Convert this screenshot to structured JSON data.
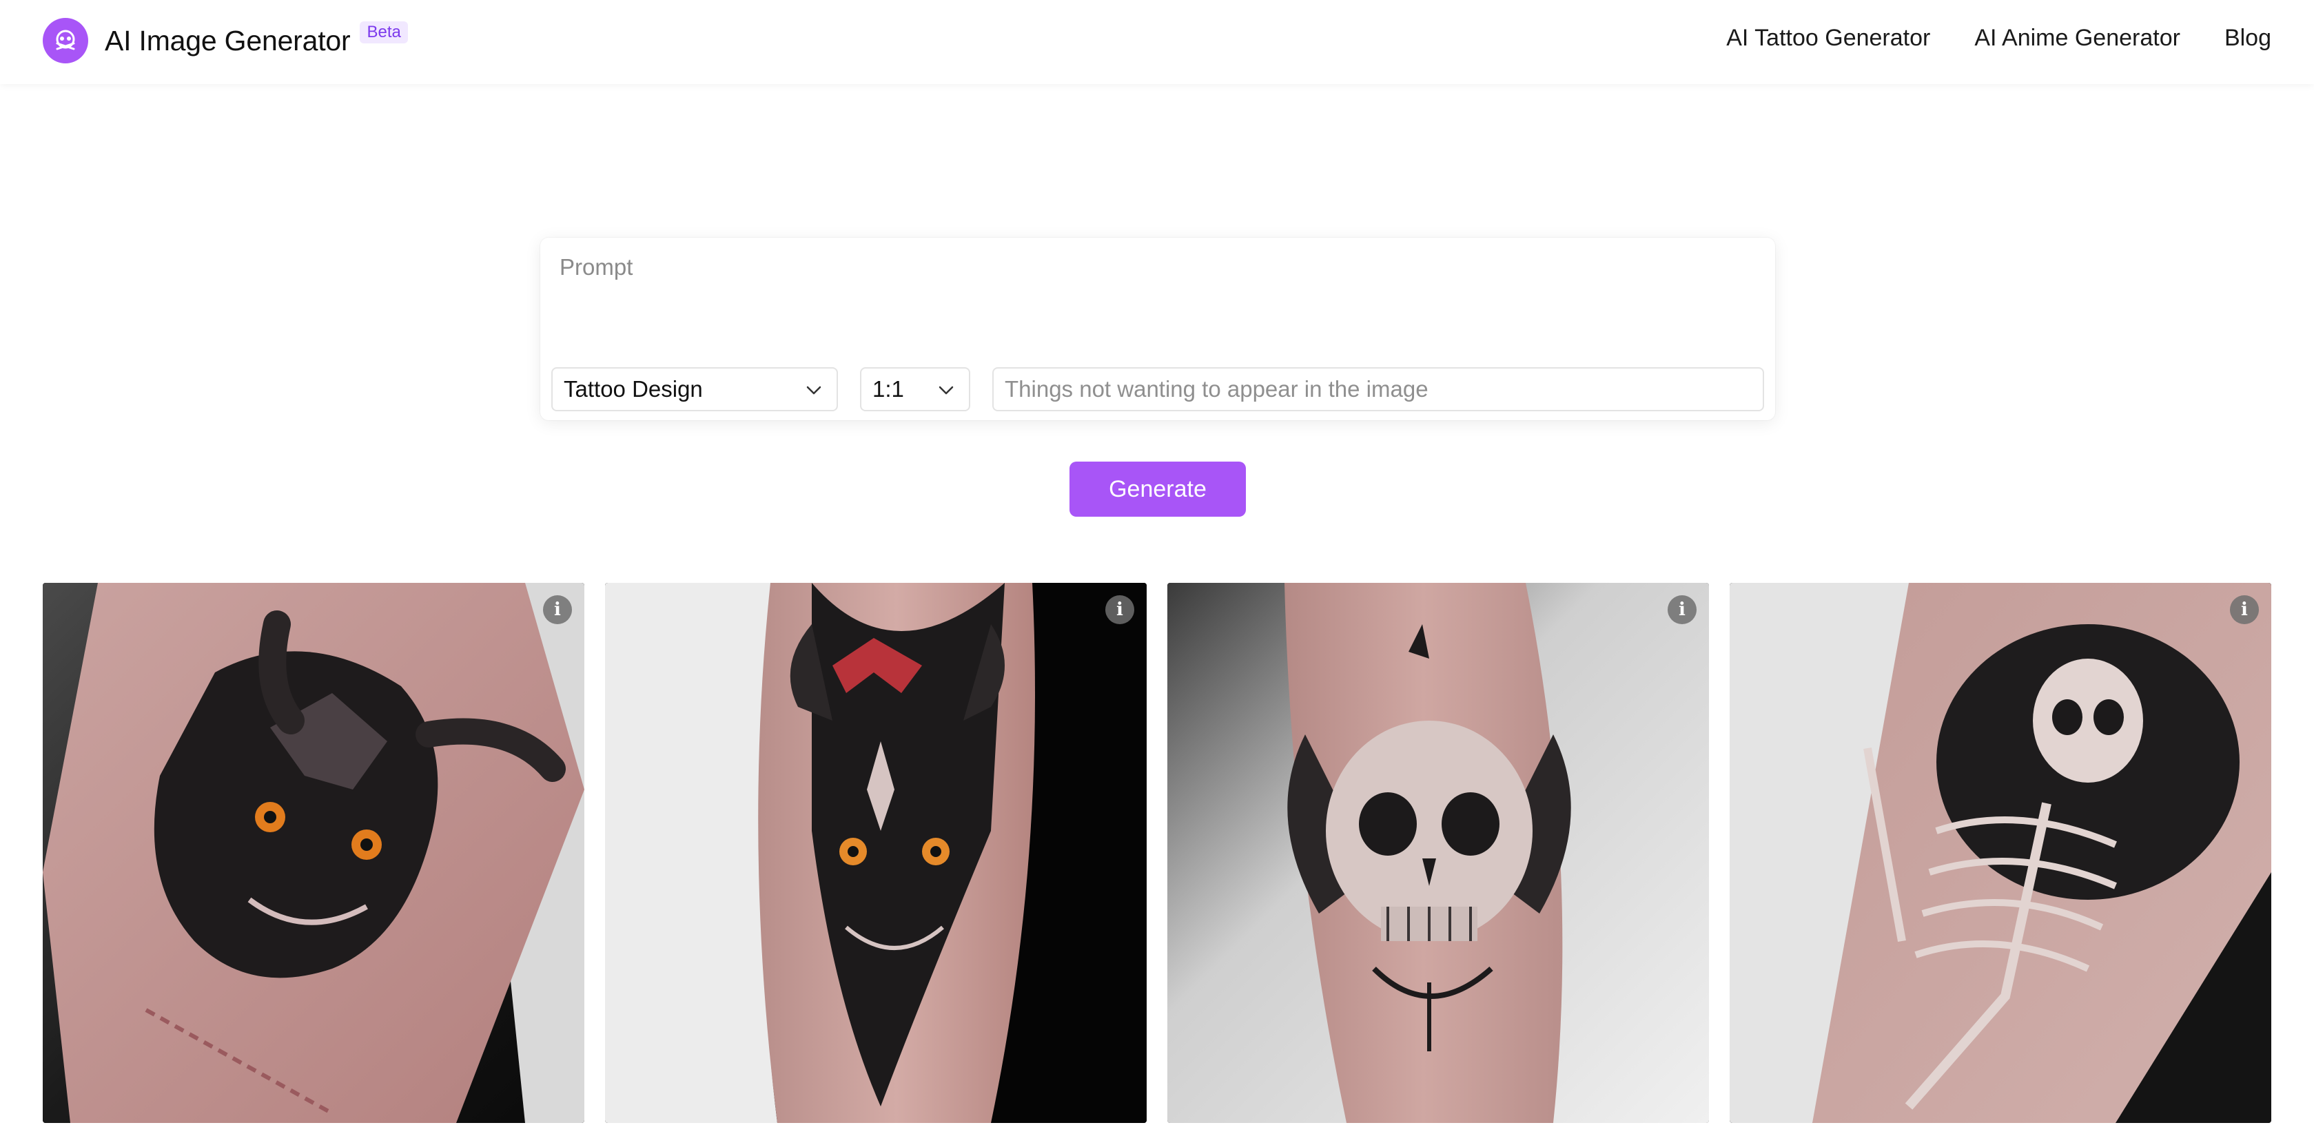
{
  "header": {
    "brand_title": "AI Image Generator",
    "beta_badge": "Beta",
    "logo_icon": "skull-logo-icon",
    "accent_color": "#a855f7",
    "nav": [
      {
        "label": "AI Tattoo Generator"
      },
      {
        "label": "AI Anime Generator"
      },
      {
        "label": "Blog"
      }
    ]
  },
  "form": {
    "prompt_placeholder": "Prompt",
    "prompt_value": "",
    "style_select": {
      "selected": "Tattoo Design",
      "icon": "chevron-down-icon"
    },
    "ratio_select": {
      "selected": "1:1",
      "icon": "chevron-down-icon"
    },
    "negative_placeholder": "Things not wanting to appear in the image",
    "negative_value": "",
    "generate_label": "Generate"
  },
  "gallery": {
    "info_glyph": "i",
    "images": [
      {
        "subject": "demon-tattoo-forearm",
        "info_icon": "info-icon"
      },
      {
        "subject": "horned-demon-mask-tattoo-arm",
        "info_icon": "info-icon"
      },
      {
        "subject": "skull-wings-tattoo-forearm",
        "info_icon": "info-icon"
      },
      {
        "subject": "skeleton-tattoo-forearm",
        "info_icon": "info-icon"
      }
    ]
  }
}
